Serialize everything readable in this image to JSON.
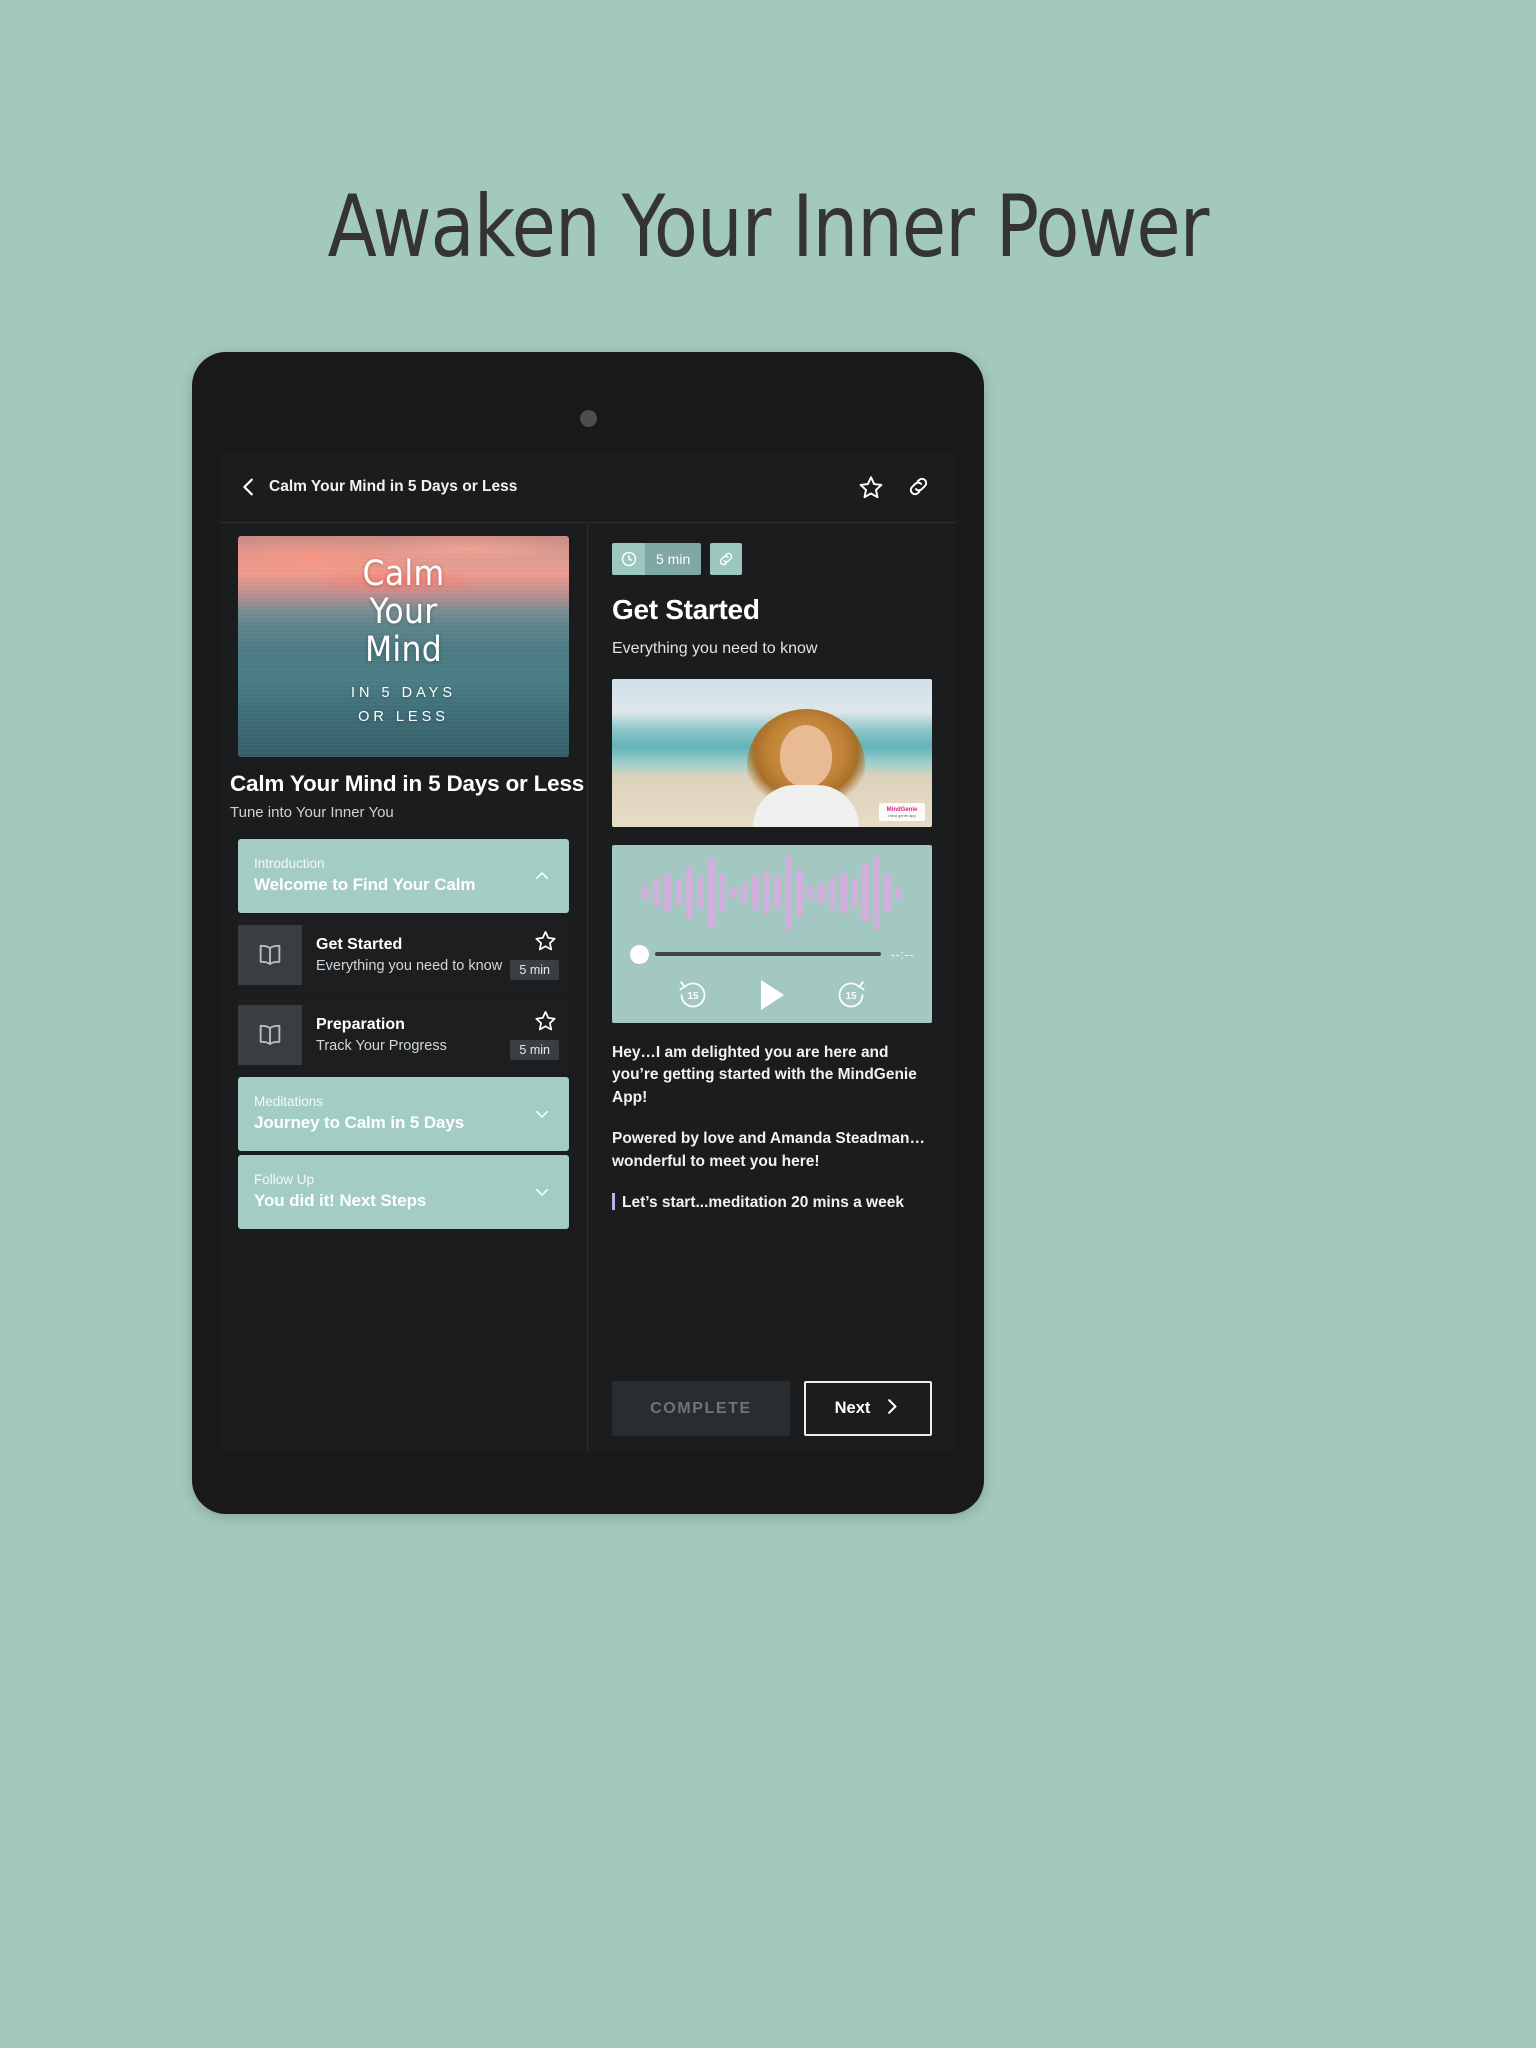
{
  "marketing": {
    "headline": "Awaken Your Inner Power",
    "background_color": "#a3c8bd"
  },
  "device": {
    "type": "tablet",
    "bezel_color": "#191919"
  },
  "app_header": {
    "back_icon": "chevron-left-icon",
    "title": "Calm Your Mind in 5 Days or Less",
    "favorite_icon": "star-outline-icon",
    "share_icon": "link-icon"
  },
  "course": {
    "cover": {
      "line1": "Calm",
      "line2": "Your",
      "line3": "Mind",
      "sub1": "IN 5 DAYS",
      "sub2": "OR LESS"
    },
    "title": "Calm Your Mind in 5 Days or Less",
    "subtitle": "Tune into Your Inner You",
    "sections": [
      {
        "kicker": "Introduction",
        "name": "Welcome to Find Your Calm",
        "expanded": true,
        "chevron": "chevron-up-icon",
        "lessons": [
          {
            "icon": "book-icon",
            "title": "Get Started",
            "desc": "Everything you need to know",
            "duration": "5 min",
            "star": "star-outline-icon"
          },
          {
            "icon": "book-icon",
            "title": "Preparation",
            "desc": "Track Your Progress",
            "duration": "5 min",
            "star": "star-outline-icon"
          }
        ]
      },
      {
        "kicker": "Meditations",
        "name": "Journey to Calm in 5 Days",
        "expanded": false,
        "chevron": "chevron-down-icon",
        "lessons": []
      },
      {
        "kicker": "Follow Up",
        "name": "You did it! Next Steps",
        "expanded": false,
        "chevron": "chevron-down-icon",
        "lessons": []
      }
    ]
  },
  "detail": {
    "clock_icon": "clock-icon",
    "duration": "5 min",
    "link_icon": "link-icon",
    "heading": "Get Started",
    "subheading": "Everything you need to know",
    "photo_alt": "instructor-beach-photo",
    "photo_logo_name": "MindGenie",
    "photo_logo_tagline": "mind genie app",
    "player": {
      "waveform_icon": "audio-waveform",
      "elapsed_time": "--:--",
      "progress_percent": 0,
      "rewind_label": "15",
      "rewind_icon": "rewind-15-icon",
      "play_icon": "play-icon",
      "forward_label": "15",
      "forward_icon": "forward-15-icon"
    },
    "body_paragraphs": [
      "Hey…I am delighted you are here and you’re getting started with the MindGenie App!",
      "Powered by love and Amanda Steadman… wonderful to meet you here!"
    ],
    "body_clipped_line": "Let’s start...meditation 20 mins a week"
  },
  "footer": {
    "complete_label": "COMPLETE",
    "next_label": "Next",
    "next_icon": "chevron-right-icon"
  },
  "colors": {
    "teal_accent": "#a3ccc4",
    "dark_bg": "#1a1c1d",
    "badge_teal": "#9cc7c0",
    "waveform_pink": "#dba9e0"
  }
}
